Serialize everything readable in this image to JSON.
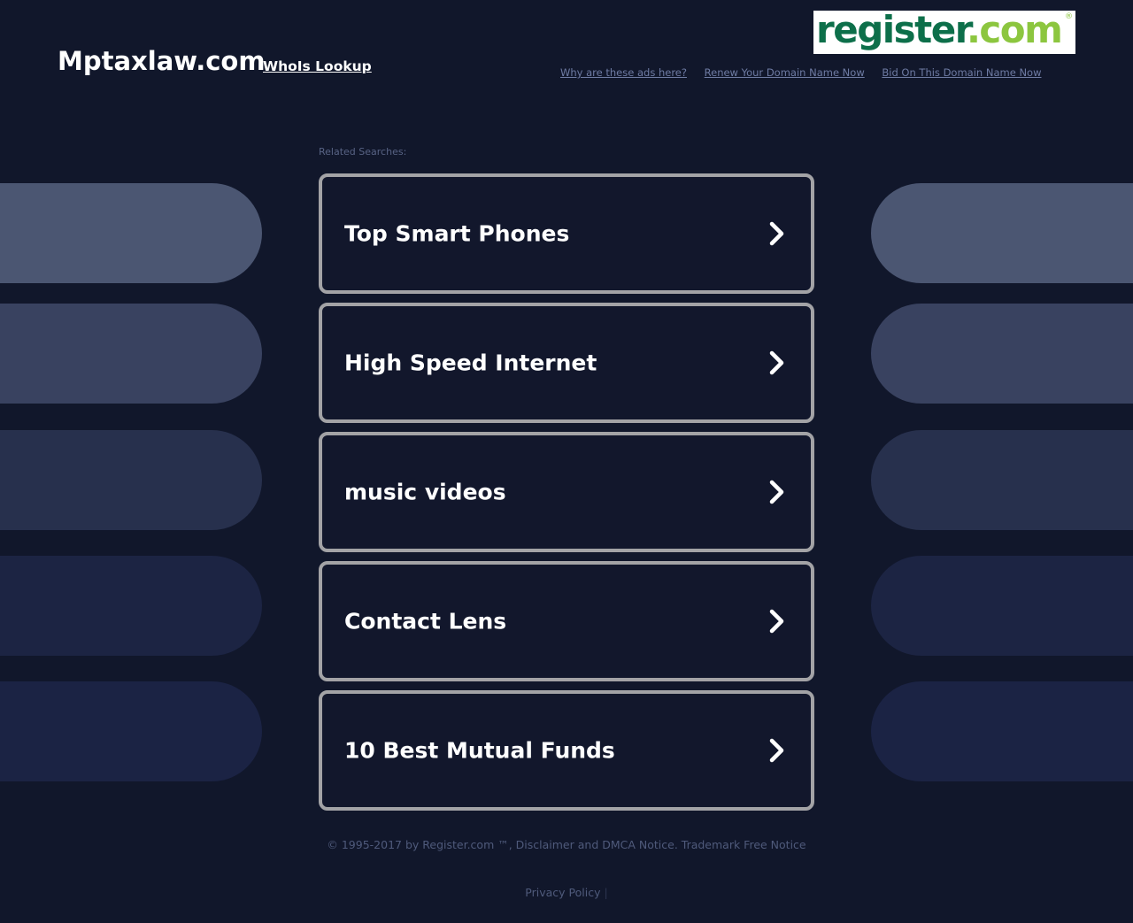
{
  "header": {
    "domain_title": "Mptaxlaw.com",
    "whois_label": "WhoIs Lookup",
    "logo": {
      "part1": "register",
      "part2": ".com",
      "registered_mark": "®",
      "colors": {
        "primary": "#0d6f4a",
        "secondary": "#8cc63f"
      }
    },
    "top_links": [
      {
        "label": "Why are these ads here?"
      },
      {
        "label": "Renew Your Domain Name Now"
      },
      {
        "label": "Bid On This Domain Name Now"
      }
    ]
  },
  "related": {
    "label": "Related Searches:",
    "items": [
      {
        "label": "Top Smart Phones",
        "icon": "chevron-right-icon"
      },
      {
        "label": "High Speed Internet",
        "icon": "chevron-right-icon"
      },
      {
        "label": "music videos",
        "icon": "chevron-right-icon"
      },
      {
        "label": "Contact Lens",
        "icon": "chevron-right-icon"
      },
      {
        "label": "10 Best Mutual Funds",
        "icon": "chevron-right-icon"
      }
    ]
  },
  "decor": {
    "pill_colors": [
      "#4b5672",
      "#394260",
      "#27304d",
      "#1c2443",
      "#1b2344"
    ]
  },
  "footer": {
    "copyright": "© 1995-2017 by Register.com ™, Disclaimer and DMCA Notice. Trademark Free Notice",
    "privacy_label": "Privacy Policy",
    "separator": "|"
  },
  "colors": {
    "background": "#11172b",
    "card_border": "#a3a3a6",
    "link_muted": "#6e7ba3"
  }
}
